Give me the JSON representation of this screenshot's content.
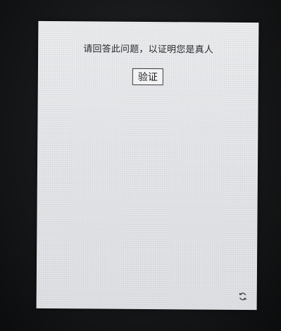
{
  "captcha": {
    "prompt": "请回答此问题，以证明您是真人",
    "verify_label": "验证",
    "refresh_icon": "refresh-icon"
  }
}
